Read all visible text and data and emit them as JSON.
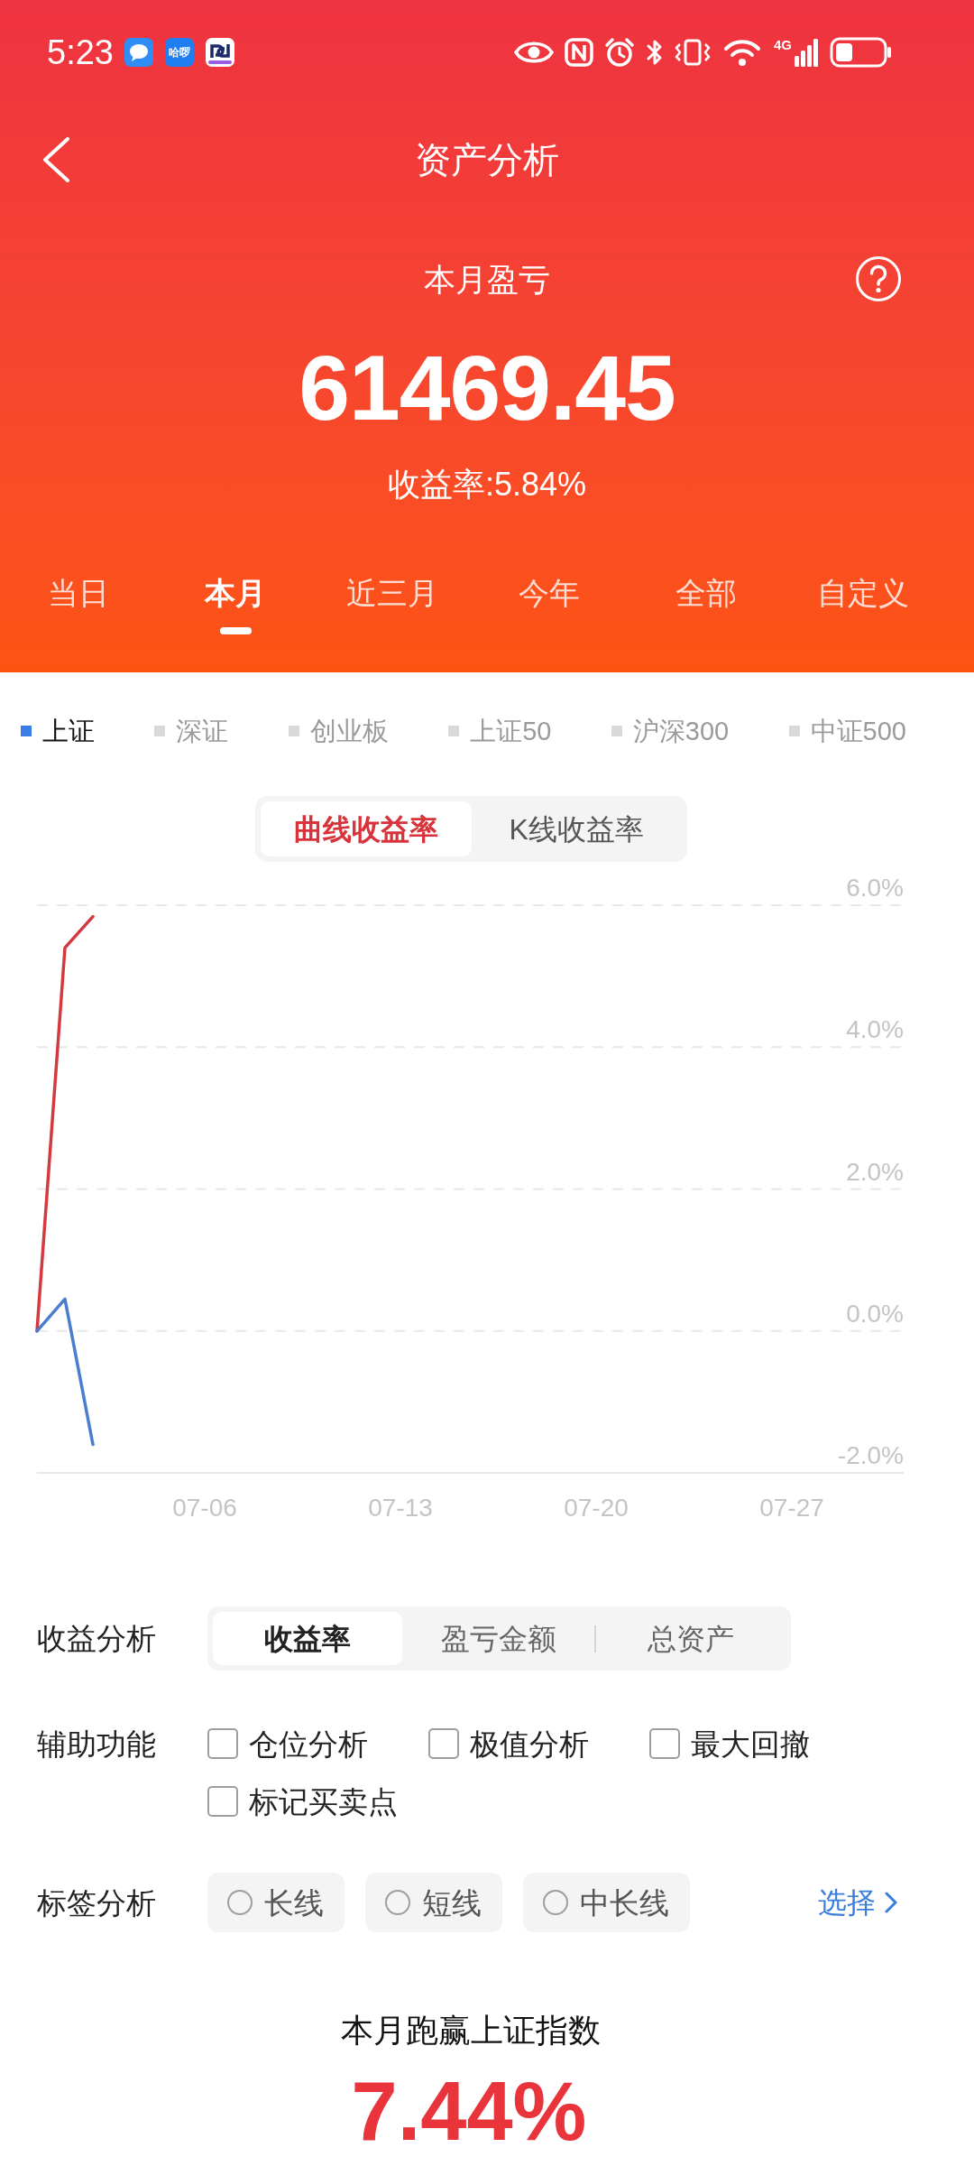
{
  "status_bar": {
    "time": "5:23",
    "notification_icons": [
      {
        "kind": "chat"
      },
      {
        "kind": "app",
        "label": "哈啰"
      },
      {
        "kind": "logo"
      }
    ],
    "network_type": "4G"
  },
  "header": {
    "title": "资产分析",
    "metric_label": "本月盈亏",
    "amount": "61469.45",
    "return_rate": "收益率:5.84%"
  },
  "period_tabs": [
    {
      "label": "当日",
      "selected": false
    },
    {
      "label": "本月",
      "selected": true
    },
    {
      "label": "近三月",
      "selected": false
    },
    {
      "label": "今年",
      "selected": false
    },
    {
      "label": "全部",
      "selected": false
    },
    {
      "label": "自定义",
      "selected": false
    }
  ],
  "index_legend": [
    {
      "label": "上证",
      "selected": true
    },
    {
      "label": "深证",
      "selected": false
    },
    {
      "label": "创业板",
      "selected": false
    },
    {
      "label": "上证50",
      "selected": false
    },
    {
      "label": "沪深300",
      "selected": false
    },
    {
      "label": "中证500",
      "selected": false
    }
  ],
  "chart_mode_tabs": [
    {
      "label": "曲线收益率",
      "selected": true
    },
    {
      "label": "K线收益率",
      "selected": false
    }
  ],
  "chart": {
    "chart_data": {
      "type": "line",
      "grid": true,
      "categories": [
        null,
        null,
        null,
        null,
        null,
        null,
        "07-06",
        null,
        null,
        null,
        null,
        null,
        null,
        "07-13",
        null,
        null,
        null,
        null,
        null,
        null,
        "07-20",
        null,
        null,
        null,
        null,
        null,
        null,
        "07-27",
        null,
        null,
        null,
        null
      ],
      "ylim": [
        -2,
        6
      ],
      "yticks": [
        {
          "value": 6,
          "label": "6.0%"
        },
        {
          "value": 4,
          "label": "4.0%"
        },
        {
          "value": 2,
          "label": "2.0%"
        },
        {
          "value": 0,
          "label": "0.0%"
        },
        {
          "value": -2,
          "label": "-2.0%"
        }
      ],
      "series": [
        {
          "color": "#d23a40",
          "values": [
            0,
            5.4,
            5.84,
            null,
            null,
            null,
            null,
            null,
            null,
            null,
            null,
            null,
            null,
            null,
            null,
            null,
            null,
            null,
            null,
            null,
            null,
            null,
            null,
            null,
            null,
            null,
            null,
            null,
            null,
            null,
            null,
            null
          ]
        },
        {
          "color": "#4a7dd0",
          "values": [
            0,
            0.45,
            -1.6,
            null,
            null,
            null,
            null,
            null,
            null,
            null,
            null,
            null,
            null,
            null,
            null,
            null,
            null,
            null,
            null,
            null,
            null,
            null,
            null,
            null,
            null,
            null,
            null,
            null,
            null,
            null,
            null,
            null
          ]
        }
      ]
    }
  },
  "profit_analysis": {
    "label": "收益分析",
    "options": [
      {
        "label": "收益率",
        "selected": true
      },
      {
        "label": "盈亏金额",
        "selected": false
      },
      {
        "label": "总资产",
        "selected": false
      }
    ]
  },
  "auxiliary_functions": {
    "label": "辅助功能",
    "options": [
      {
        "label": "仓位分析",
        "checked": false
      },
      {
        "label": "极值分析",
        "checked": false
      },
      {
        "label": "最大回撤",
        "checked": false
      },
      {
        "label": "标记买卖点",
        "checked": false
      }
    ]
  },
  "tag_analysis": {
    "label": "标签分析",
    "options": [
      {
        "label": "长线",
        "selected": false
      },
      {
        "label": "短线",
        "selected": false
      },
      {
        "label": "中长线",
        "selected": false
      }
    ],
    "select_link": "选择"
  },
  "comparison": {
    "title": "本月跑赢上证指数",
    "value": "7.44%"
  }
}
